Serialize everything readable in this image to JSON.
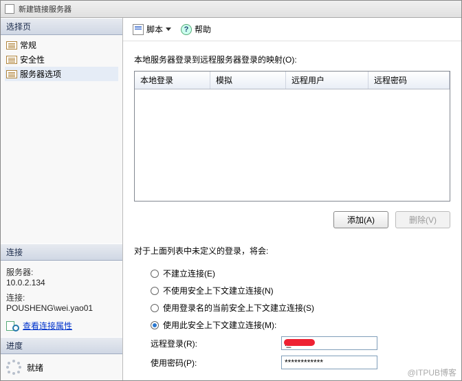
{
  "titlebar": {
    "text": "新建链接服务器"
  },
  "sidebar": {
    "select_page": {
      "header": "选择页",
      "items": [
        "常规",
        "安全性",
        "服务器选项"
      ]
    },
    "connection": {
      "header": "连接",
      "server_label": "服务器:",
      "server_value": "10.0.2.134",
      "conn_label": "连接:",
      "conn_value": "POUSHENG\\wei.yao01",
      "view_props": "查看连接属性"
    },
    "progress": {
      "header": "进度",
      "status": "就绪"
    }
  },
  "toolbar": {
    "script": "脚本",
    "help": "帮助"
  },
  "main": {
    "mapping_label": "本地服务器登录到远程服务器登录的映射(O):",
    "table": {
      "headers": [
        "本地登录",
        "模拟",
        "远程用户",
        "远程密码"
      ]
    },
    "add_btn": "添加(A)",
    "delete_btn": "删除(V)",
    "undefined_note": "对于上面列表中未定义的登录，将会:",
    "radios": [
      "不建立连接(E)",
      "不使用安全上下文建立连接(N)",
      "使用登录名的当前安全上下文建立连接(S)",
      "使用此安全上下文建立连接(M):"
    ],
    "remote_login_label": "远程登录(R):",
    "remote_login_value": "l_r",
    "password_label": "使用密码(P):",
    "password_value": "************"
  },
  "watermark": "@ITPUB博客"
}
